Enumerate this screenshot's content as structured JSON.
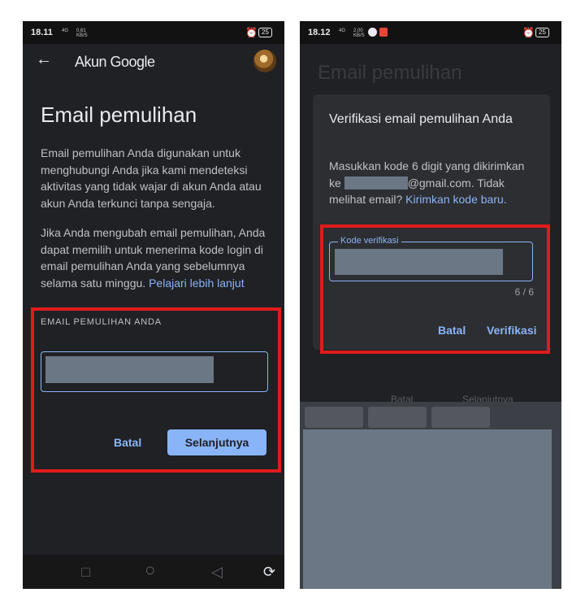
{
  "left": {
    "status": {
      "time": "18.11",
      "signal": "4G",
      "speed_top": "0,61",
      "speed_bottom": "KB/S",
      "battery": "25"
    },
    "appbar": {
      "back": "←",
      "title": "Akun Google"
    },
    "page_title": "Email pemulihan",
    "para1": "Email pemulihan Anda digunakan untuk menghubungi Anda jika kami mendeteksi aktivitas yang tidak wajar di akun Anda atau akun Anda terkunci tanpa sengaja.",
    "para2": "Jika Anda mengubah email pemulihan, Anda dapat memilih untuk menerima kode login di email pemulihan Anda yang sebelumnya selama satu minggu.",
    "learn_more": "Pelajari lebih lanjut",
    "field_label": "EMAIL PEMULIHAN ANDA",
    "cancel": "Batal",
    "next": "Selanjutnya",
    "nav": {
      "square": "□",
      "circle": "○",
      "back": "◁",
      "rotate": "⟳"
    }
  },
  "right": {
    "status": {
      "time": "18.12",
      "signal": "4G",
      "speed_top": "2,00",
      "speed_bottom": "KB/S",
      "battery": "25"
    },
    "bg_title": "Email pemulihan",
    "dialog": {
      "title": "Verifikasi email pemulihan Anda",
      "body_prefix": "Masukkan kode 6 digit yang dikirimkan ke ",
      "email_suffix": "@gmail.com. Tidak melihat email? ",
      "resend": "Kirimkan kode baru.",
      "code_label": "Kode verifikasi",
      "counter": "6 / 6",
      "cancel": "Batal",
      "verify": "Verifikasi"
    },
    "ghost_buttons": {
      "cancel": "Batal",
      "next": "Selanjutnya"
    }
  },
  "colors": {
    "accent": "#8ab4f8",
    "highlight": "#e01b1b",
    "background": "#202124",
    "redaction": "#6b7785"
  }
}
